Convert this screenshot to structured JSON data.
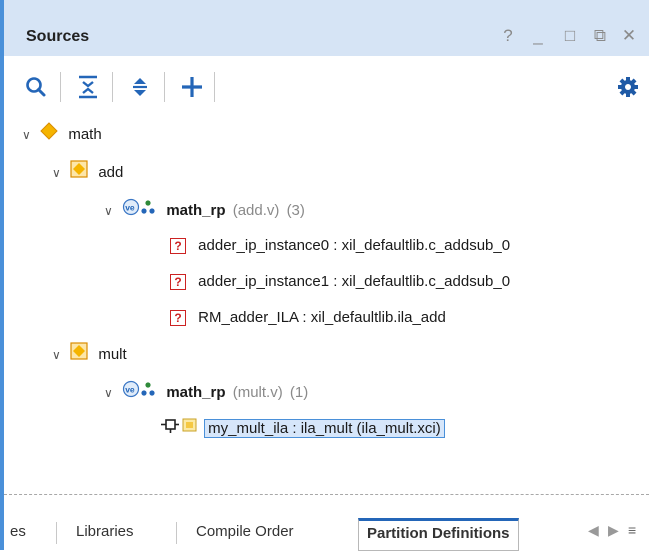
{
  "window": {
    "title": "Sources",
    "buttons": [
      "?",
      "_",
      "□",
      "⧉",
      "✕"
    ]
  },
  "toolbar": {
    "icons": [
      "search-icon",
      "collapse-all-icon",
      "expand-all-icon",
      "add-icon",
      "gear-icon"
    ]
  },
  "tree": {
    "root": {
      "label": "math"
    },
    "add": {
      "label": "add"
    },
    "add_rp": {
      "name": "math_rp",
      "file": "(add.v)",
      "count": "(3)"
    },
    "add_children": [
      "adder_ip_instance0 : xil_defaultlib.c_addsub_0",
      "adder_ip_instance1 : xil_defaultlib.c_addsub_0",
      "RM_adder_ILA : xil_defaultlib.ila_add"
    ],
    "mult": {
      "label": "mult"
    },
    "mult_rp": {
      "name": "math_rp",
      "file": "(mult.v)",
      "count": "(1)"
    },
    "mult_child": "my_mult_ila : ila_mult (ila_mult.xci)"
  },
  "tabs": {
    "items": [
      "es",
      "Libraries",
      "Compile Order",
      "Partition Definitions"
    ],
    "active": "Partition Definitions"
  },
  "colors": {
    "accent": "#4a90d9",
    "titlebar": "#d6e4f5",
    "diamond": "#f5b400",
    "error": "#cc2222"
  }
}
